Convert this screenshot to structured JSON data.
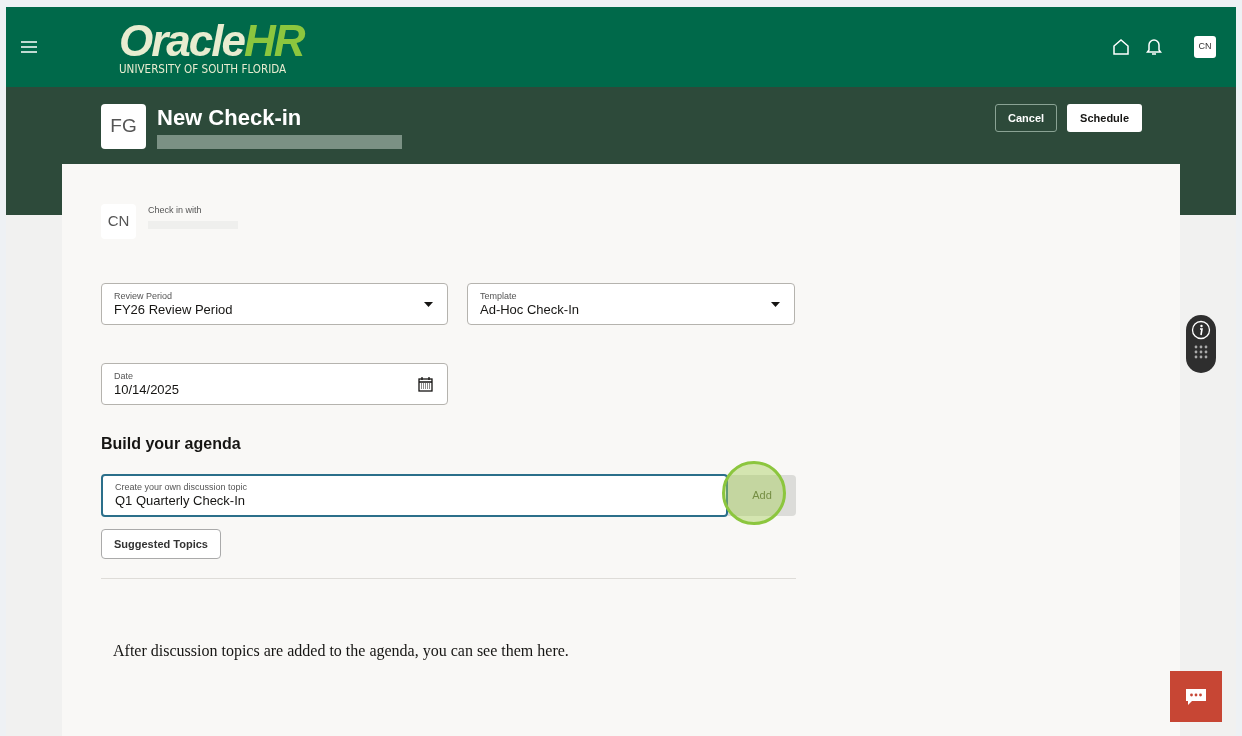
{
  "header": {
    "logo_main": "Oracle",
    "logo_accent": "HR",
    "logo_sub": "UNIVERSITY OF SOUTH FLORIDA",
    "user_initials": "CN"
  },
  "page": {
    "avatar": "FG",
    "title": "New Check-in",
    "buttons": [
      {
        "label": "Cancel",
        "kind": "secondary"
      },
      {
        "label": "Schedule",
        "kind": "primary"
      }
    ]
  },
  "check_in_with": {
    "avatar": "CN",
    "label": "Check in with"
  },
  "fields": [
    {
      "label": "Review Period",
      "value": "FY26 Review Period",
      "kind": "select"
    },
    {
      "label": "Template",
      "value": "Ad-Hoc Check-In",
      "kind": "select"
    },
    {
      "label": "Date",
      "value": "10/14/2025",
      "kind": "date"
    }
  ],
  "agenda": {
    "heading": "Build your agenda",
    "topic_label": "Create your own discussion topic",
    "topic_value": "Q1 Quarterly Check-In",
    "add_button": "Add",
    "add_highlighted": true,
    "suggested_button": "Suggested Topics",
    "empty_message": "After discussion topics are added to the agenda, you can see them here."
  }
}
